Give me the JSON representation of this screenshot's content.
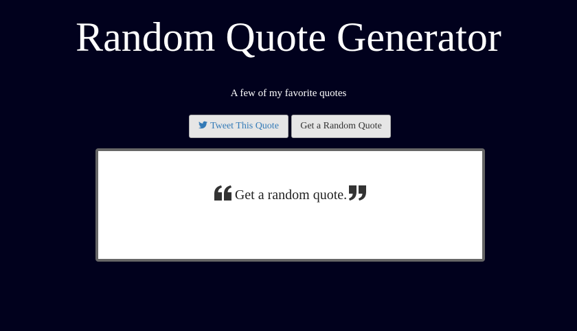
{
  "header": {
    "title": "Random Quote Generator",
    "subtitle": "A few of my favorite quotes"
  },
  "actions": {
    "tweet_label": "Tweet This Quote",
    "random_label": "Get a Random Quote"
  },
  "quote": {
    "text": "Get a random quote."
  },
  "icons": {
    "tweet": "twitter-icon",
    "open_quote": "quote-left-icon",
    "close_quote": "quote-right-icon"
  },
  "colors": {
    "page_background": "#01011d",
    "title_text": "#ffffff",
    "button_background": "#e6e6e6",
    "tweet_text": "#337ab7",
    "button_text": "#333333",
    "quote_border": "#666666",
    "quote_text": "#222222"
  }
}
